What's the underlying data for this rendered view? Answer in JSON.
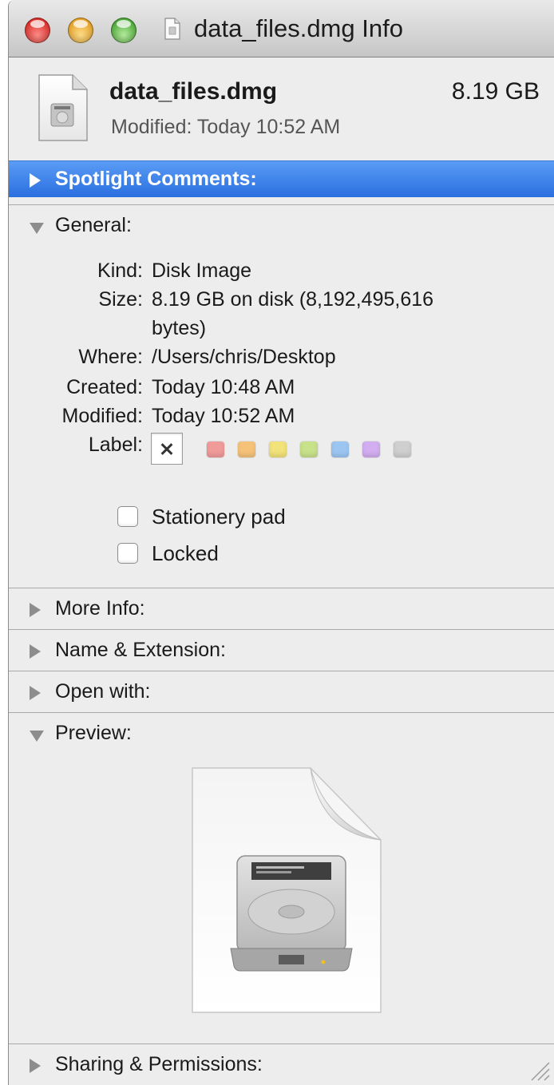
{
  "window": {
    "title": "data_files.dmg Info"
  },
  "header": {
    "file_name": "data_files.dmg",
    "file_size": "8.19 GB",
    "modified": "Modified: Today 10:52 AM"
  },
  "sections": {
    "spotlight": {
      "label": "Spotlight Comments:",
      "expanded": false,
      "selected": true
    },
    "general": {
      "label": "General:",
      "expanded": true
    },
    "more_info": {
      "label": "More Info:",
      "expanded": false
    },
    "name_ext": {
      "label": "Name & Extension:",
      "expanded": false
    },
    "open_with": {
      "label": "Open with:",
      "expanded": false
    },
    "preview": {
      "label": "Preview:",
      "expanded": true
    },
    "sharing": {
      "label": "Sharing & Permissions:",
      "expanded": false
    }
  },
  "general": {
    "kind_key": "Kind:",
    "kind_val": "Disk Image",
    "size_key": "Size:",
    "size_val_1": "8.19 GB on disk (8,192,495,616",
    "size_val_2": "bytes)",
    "where_key": "Where:",
    "where_val": "/Users/chris/Desktop",
    "created_key": "Created:",
    "created_val": "Today 10:48 AM",
    "modified_key": "Modified:",
    "modified_val": "Today 10:52 AM",
    "label_key": "Label:",
    "label_colors": [
      "#f09a9a",
      "#f5c27a",
      "#f2e27a",
      "#c8e28a",
      "#9cc6f2",
      "#d2aef0",
      "#cfcfcf"
    ],
    "stationery_label": "Stationery pad",
    "stationery_checked": false,
    "locked_label": "Locked",
    "locked_checked": false
  },
  "icons": {
    "file": "disk-image-document-icon",
    "preview": "hard-drive-icon"
  }
}
